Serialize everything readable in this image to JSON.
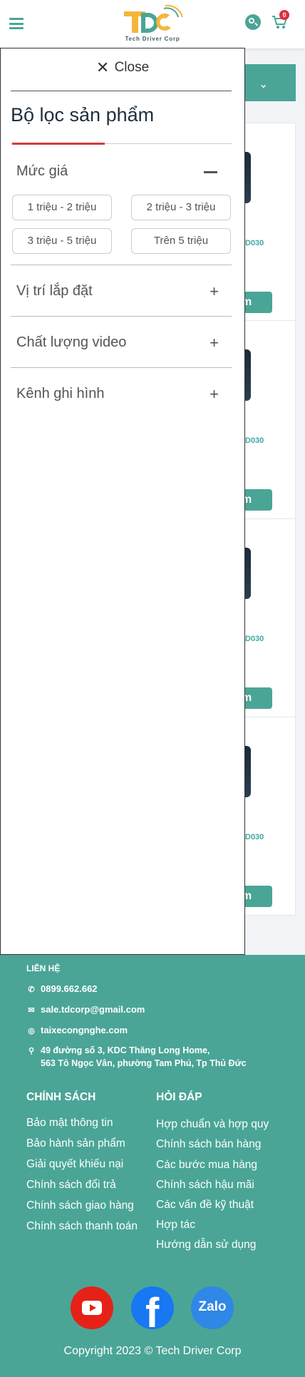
{
  "header": {
    "menu_icon": "hamburger-icon",
    "logo_text": "Tech Driver Corp",
    "search_icon": "search-icon",
    "cart_icon": "cart-icon",
    "cart_count": "0",
    "accent_color": "#4aa596"
  },
  "background_list": {
    "filter_toggle_icon": "chevron-down-icon",
    "items": [
      {
        "code_fragment": "D030",
        "button_fragment": "m"
      },
      {
        "code_fragment": "D030",
        "button_fragment": "m"
      },
      {
        "code_fragment": "D030",
        "button_fragment": "m"
      },
      {
        "code_fragment": "D030",
        "button_fragment": "m"
      }
    ]
  },
  "drawer": {
    "close_label": "Close",
    "title": "Bộ lọc sản phẩm",
    "sections": [
      {
        "label": "Mức giá",
        "expanded": true
      },
      {
        "label": "Vị trí lắp đặt",
        "expanded": false
      },
      {
        "label": "Chất lượng video",
        "expanded": false
      },
      {
        "label": "Kênh ghi hình",
        "expanded": false
      }
    ],
    "price_options": [
      "1 triệu - 2 triệu",
      "2 triệu - 3 triệu",
      "3 triệu - 5 triệu",
      "Trên 5 triệu"
    ]
  },
  "footer": {
    "contact_heading": "LIÊN HỆ",
    "phone": "0899.662.662",
    "email": "sale.tdcorp@gmail.com",
    "website": "taixecongnghe.com",
    "address_line1": "49 đường số 3, KDC Thăng Long Home,",
    "address_line2": "563 Tô Ngọc Vân, phường Tam Phú, Tp Thủ Đức",
    "policy_heading": "CHÍNH SÁCH",
    "policy_links": [
      "Bảo mật thông tin",
      "Bảo hành sản phẩm",
      "Giải quyết khiếu nại",
      "Chính sách đổi trả",
      "Chính sách giao hàng",
      "Chính sách thanh toán"
    ],
    "faq_heading": "HỎI ĐÁP",
    "faq_links": [
      "Hợp chuẩn và hợp quy",
      "Chính sách bán hàng",
      "Các bước mua hàng",
      "Chính sách hậu mãi",
      "Các vấn đề kỹ thuật",
      "Hợp tác",
      "Hướng dẫn sử dụng"
    ],
    "social": {
      "youtube_icon": "youtube-icon",
      "facebook_icon": "facebook-icon",
      "zalo_label": "Zalo"
    },
    "copyright": "Copyright 2023 © Tech Driver Corp",
    "background_color": "#4aa596"
  }
}
